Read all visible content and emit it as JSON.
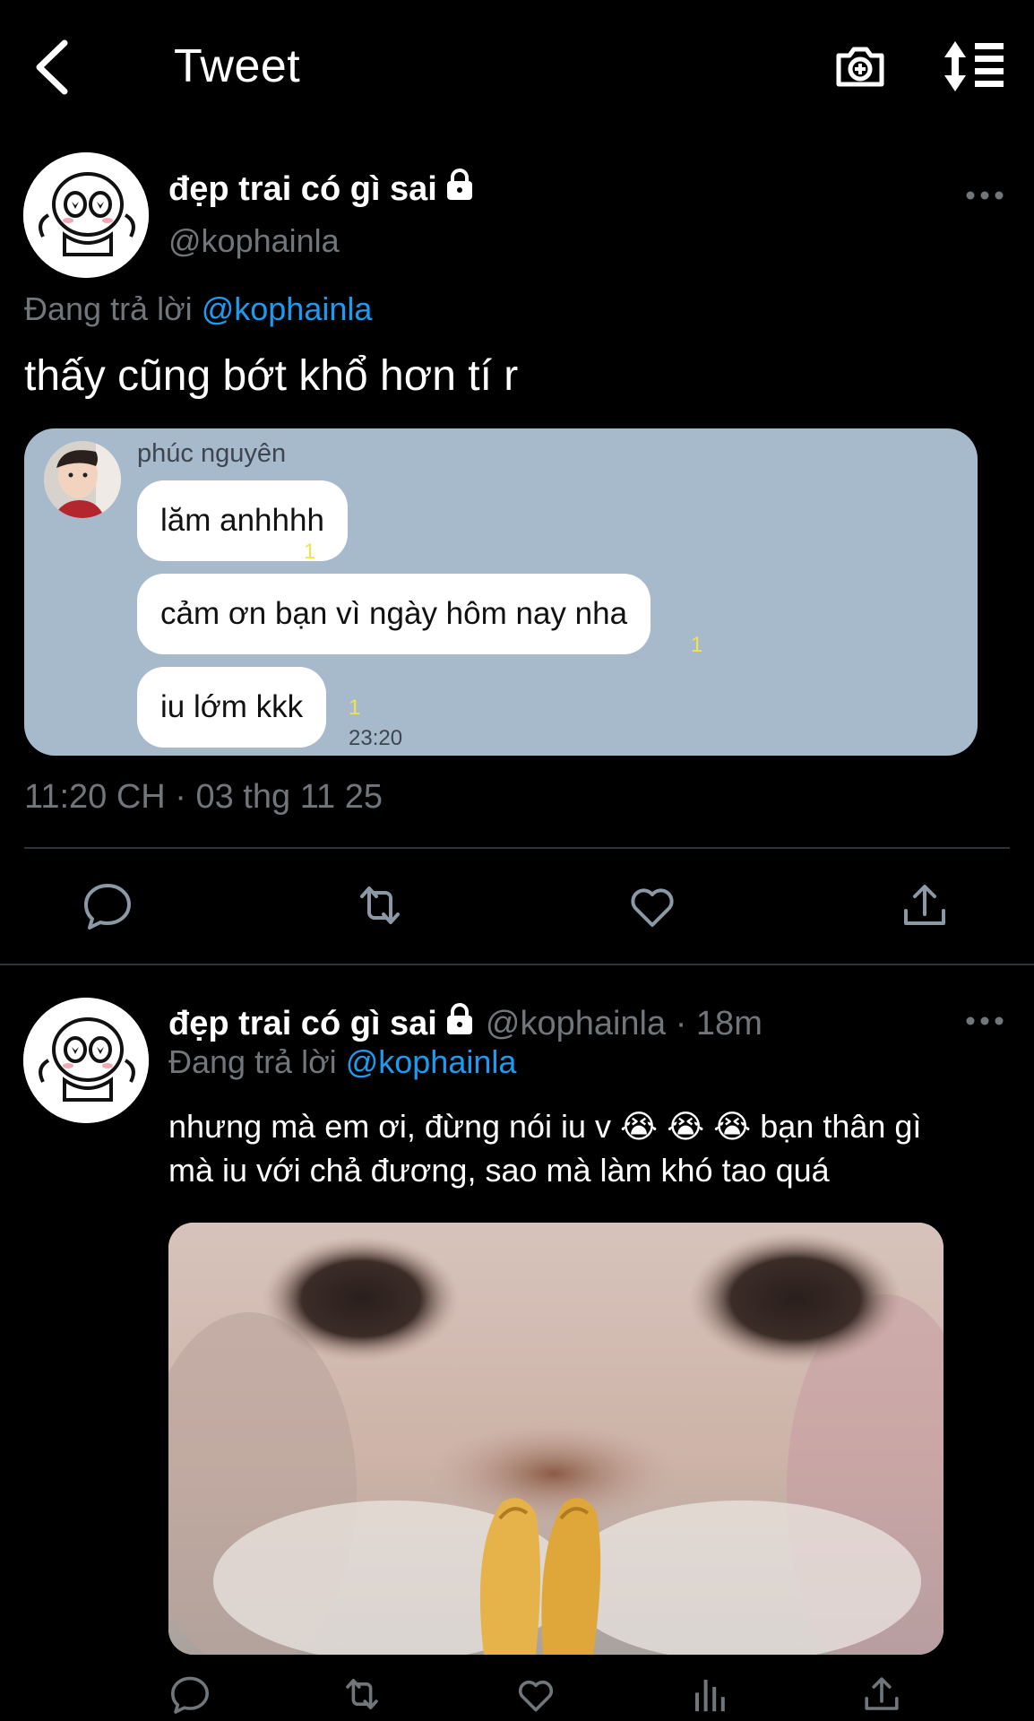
{
  "header": {
    "title": "Tweet",
    "back_icon": "chevron-left-icon",
    "camera_icon": "camera-plus-icon",
    "sort_icon": "sort-list-icon"
  },
  "main_tweet": {
    "display_name": "đẹp trai có gì sai",
    "handle": "@kophainla",
    "reply_prefix": "Đang trả lời",
    "reply_to": "@kophainla",
    "text": "thấy cũng bớt khổ hơn tí r",
    "chat_screenshot": {
      "sender": "phúc nguyên",
      "messages": [
        {
          "text": "lăm anhhhh",
          "read": "1"
        },
        {
          "text": "cảm ơn bạn vì ngày hôm nay nha",
          "read": "1"
        },
        {
          "text": "iu lớm kkk",
          "read": "1"
        }
      ],
      "time": "23:20"
    },
    "timestamp": "11:20 CH · 03 thg 11 25"
  },
  "reply_tweet": {
    "display_name": "đẹp trai có gì sai",
    "handle": "@kophainla",
    "age": "18m",
    "reply_prefix": "Đang trả lời",
    "reply_to": "@kophainla",
    "text_line1": "nhưng mà em ơi, đừng nói iu v 😭 😭 😭  bạn thân gì",
    "text_line2": "mà iu với chả đương, sao mà làm khó tao quá"
  },
  "colors": {
    "background": "#000000",
    "muted": "#71767b",
    "link": "#1d9bf0",
    "chat_bg": "#a6bacc",
    "read_receipt": "#f3e24a"
  }
}
